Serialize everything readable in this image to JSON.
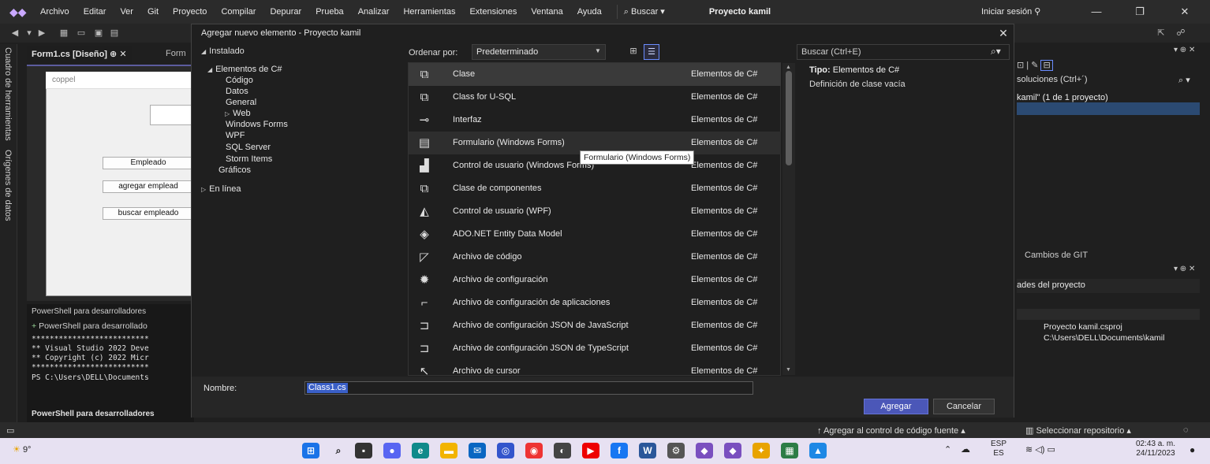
{
  "menubar": {
    "items": [
      "Archivo",
      "Editar",
      "Ver",
      "Git",
      "Proyecto",
      "Compilar",
      "Depurar",
      "Prueba",
      "Analizar",
      "Herramientas",
      "Extensiones",
      "Ventana",
      "Ayuda"
    ],
    "search": "Buscar",
    "project": "Proyecto kamil",
    "signin": "Iniciar sesión"
  },
  "vtabs": [
    "Cuadro de herramientas",
    "Orígenes de datos"
  ],
  "editor": {
    "tab_active": "Form1.cs [Diseño]",
    "tab_other": "Form",
    "form_title": "coppel",
    "buttons": [
      "Empleado",
      "agregar emplead",
      "buscar empleado"
    ]
  },
  "powershell": {
    "title": "PowerShell para desarrolladores",
    "add": "PowerShell para desarrollado",
    "lines": [
      "**************************",
      "** Visual Studio 2022 Deve",
      "** Copyright (c) 2022 Micr",
      "**************************",
      "PS C:\\Users\\DELL\\Documents"
    ],
    "bottom_tab": "PowerShell para desarrolladores"
  },
  "dialog": {
    "title": "Agregar nuevo elemento - Proyecto kamil",
    "tree_header": "Instalado",
    "tree": [
      {
        "label": "Elementos de C#",
        "level": 0,
        "expanded": true
      },
      {
        "label": "Código",
        "level": 1
      },
      {
        "label": "Datos",
        "level": 1
      },
      {
        "label": "General",
        "level": 1
      },
      {
        "label": "Web",
        "level": 1,
        "collapsed": true
      },
      {
        "label": "Windows Forms",
        "level": 1
      },
      {
        "label": "WPF",
        "level": 1
      },
      {
        "label": "SQL Server",
        "level": 1
      },
      {
        "label": "Storm Items",
        "level": 1
      },
      {
        "label": "Gráficos",
        "level": 0
      }
    ],
    "online": "En línea",
    "sort_label": "Ordenar por:",
    "sort_value": "Predeterminado",
    "items": [
      {
        "name": "Clase",
        "category": "Elementos de C#",
        "icon": "class-icon",
        "selected": true
      },
      {
        "name": "Class for U-SQL",
        "category": "Elementos de C#",
        "icon": "usql-class-icon"
      },
      {
        "name": "Interfaz",
        "category": "Elementos de C#",
        "icon": "interface-icon"
      },
      {
        "name": "Formulario (Windows Forms)",
        "category": "Elementos de C#",
        "icon": "form-icon",
        "hover": true
      },
      {
        "name": "Control de usuario (Windows Forms)",
        "category": "Elementos de C#",
        "icon": "user-control-icon"
      },
      {
        "name": "Clase de componentes",
        "category": "Elementos de C#",
        "icon": "component-class-icon"
      },
      {
        "name": "Control de usuario (WPF)",
        "category": "Elementos de C#",
        "icon": "wpf-user-control-icon"
      },
      {
        "name": "ADO.NET Entity Data Model",
        "category": "Elementos de C#",
        "icon": "entity-model-icon"
      },
      {
        "name": "Archivo de código",
        "category": "Elementos de C#",
        "icon": "code-file-icon"
      },
      {
        "name": "Archivo de configuración",
        "category": "Elementos de C#",
        "icon": "config-file-icon"
      },
      {
        "name": "Archivo de configuración de aplicaciones",
        "category": "Elementos de C#",
        "icon": "app-config-icon"
      },
      {
        "name": "Archivo de configuración JSON de JavaScript",
        "category": "Elementos de C#",
        "icon": "js-json-config-icon"
      },
      {
        "name": "Archivo de configuración JSON de TypeScript",
        "category": "Elementos de C#",
        "icon": "ts-json-config-icon"
      },
      {
        "name": "Archivo de cursor",
        "category": "Elementos de C#",
        "icon": "cursor-file-icon"
      }
    ],
    "tooltip": "Formulario (Windows Forms)",
    "search_placeholder": "Buscar (Ctrl+E)",
    "type_label": "Tipo:",
    "type_value": "Elementos de C#",
    "type_description": "Definición de clase vacía",
    "name_label": "Nombre:",
    "name_value": "Class1.cs",
    "btn_add": "Agregar",
    "btn_cancel": "Cancelar"
  },
  "right_panel": {
    "solutions_search": "soluciones (Ctrl+´)",
    "project_line": "kamil\" (1 de 1 proyecto)",
    "git_tab": "Cambios de GIT",
    "properties_title": "ades del proyecto",
    "file_name": "Proyecto kamil.csproj",
    "file_path": "C:\\Users\\DELL\\Documents\\kamil"
  },
  "statusbar": {
    "source_control": "Agregar al control de código fuente",
    "repo": "Seleccionar repositorio"
  },
  "taskbar": {
    "weather": "9°",
    "lang_top": "ESP",
    "lang_bottom": "ES",
    "time": "02:43 a. m.",
    "date": "24/11/2023"
  }
}
